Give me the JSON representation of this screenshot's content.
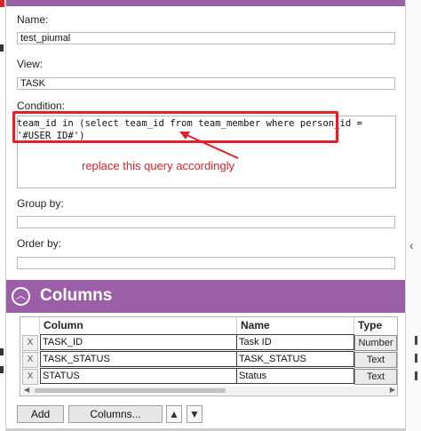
{
  "form": {
    "name_label": "Name:",
    "name_value": "test_piumal",
    "view_label": "View:",
    "view_value": "TASK",
    "condition_label": "Condition:",
    "condition_lines": [
      "team_id in (select team_id from team_member where person_id =",
      "'#USER_ID#')"
    ],
    "group_by_label": "Group by:",
    "group_by_value": "",
    "order_by_label": "Order by:",
    "order_by_value": ""
  },
  "annotation": {
    "text": "replace this query accordingly",
    "color": "#e0212a"
  },
  "columns": {
    "title": "Columns",
    "headers": {
      "column": "Column",
      "name": "Name",
      "type": "Type"
    },
    "rows": [
      {
        "remove": "X",
        "column": "TASK_ID",
        "name": "Task ID",
        "type": "Number"
      },
      {
        "remove": "X",
        "column": "TASK_STATUS",
        "name": "TASK_STATUS",
        "type": "Text"
      },
      {
        "remove": "X",
        "column": "STATUS",
        "name": "Status",
        "type": "Text"
      }
    ]
  },
  "buttons": {
    "add": "Add",
    "columns": "Columns...",
    "up": "▲",
    "down": "▼"
  },
  "colors": {
    "accent": "#9a5fa6",
    "highlight": "#e0212a"
  },
  "icons": {
    "collapse": "chevron-up-circle-icon",
    "side_toggle": "chevron-left-icon"
  }
}
